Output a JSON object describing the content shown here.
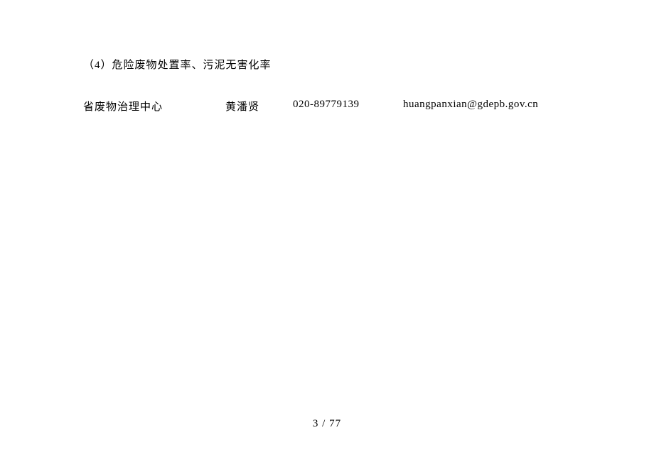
{
  "heading": "（4）危险废物处置率、污泥无害化率",
  "contact": {
    "org": "省废物治理中心",
    "name": "黄潘贤",
    "phone": "020-89779139",
    "email": "huangpanxian@gdepb.gov.cn"
  },
  "pageNumber": "3 / 77"
}
